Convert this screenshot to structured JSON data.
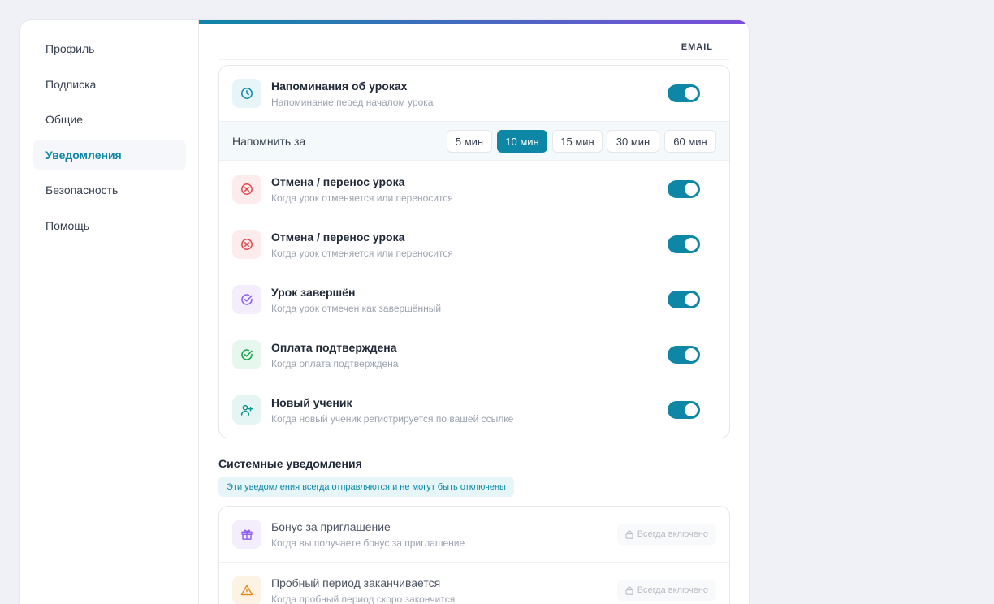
{
  "sidebar": {
    "items": [
      {
        "label": "Профиль"
      },
      {
        "label": "Подписка"
      },
      {
        "label": "Общие"
      },
      {
        "label": "Уведомления"
      },
      {
        "label": "Безопасность"
      },
      {
        "label": "Помощь"
      }
    ],
    "active_index": 3
  },
  "main": {
    "column_header": "EMAIL",
    "lesson_reminders": {
      "title": "Напоминания об уроках",
      "subtitle": "Напоминание перед началом урока",
      "enabled": true,
      "icon": "clock-icon"
    },
    "remind": {
      "label": "Напомнить за",
      "options": [
        "5 мин",
        "10 мин",
        "15 мин",
        "30 мин",
        "60 мин"
      ],
      "selected": "10 мин"
    },
    "notifications": [
      {
        "title": "Отмена / перенос урока",
        "subtitle": "Когда урок отменяется или переносится",
        "enabled": true,
        "icon": "x-circle-icon"
      },
      {
        "title": "Отмена / перенос урока",
        "subtitle": "Когда урок отменяется или переносится",
        "enabled": true,
        "icon": "x-circle-icon"
      },
      {
        "title": "Урок завершён",
        "subtitle": "Когда урок отмечен как завершённый",
        "enabled": true,
        "icon": "check-circle-icon"
      },
      {
        "title": "Оплата подтверждена",
        "subtitle": "Когда оплата подтверждена",
        "enabled": true,
        "icon": "check-circle-icon"
      },
      {
        "title": "Новый ученик",
        "subtitle": "Когда новый ученик регистрируется по вашей ссылке",
        "enabled": true,
        "icon": "user-plus-icon"
      }
    ],
    "system": {
      "title": "Системные уведомления",
      "note": "Эти уведомления всегда отправляются и не могут быть отключены",
      "items": [
        {
          "title": "Бонус за приглашение",
          "subtitle": "Когда вы получаете бонус за приглашение",
          "badge": "Всегда включено",
          "icon": "gift-icon"
        },
        {
          "title": "Пробный период заканчивается",
          "subtitle": "Когда пробный период скоро закончится",
          "badge": "Всегда включено",
          "icon": "warning-icon"
        }
      ]
    }
  },
  "colors": {
    "accent": "#0e87a6",
    "accent_end": "#7c4ddb"
  }
}
